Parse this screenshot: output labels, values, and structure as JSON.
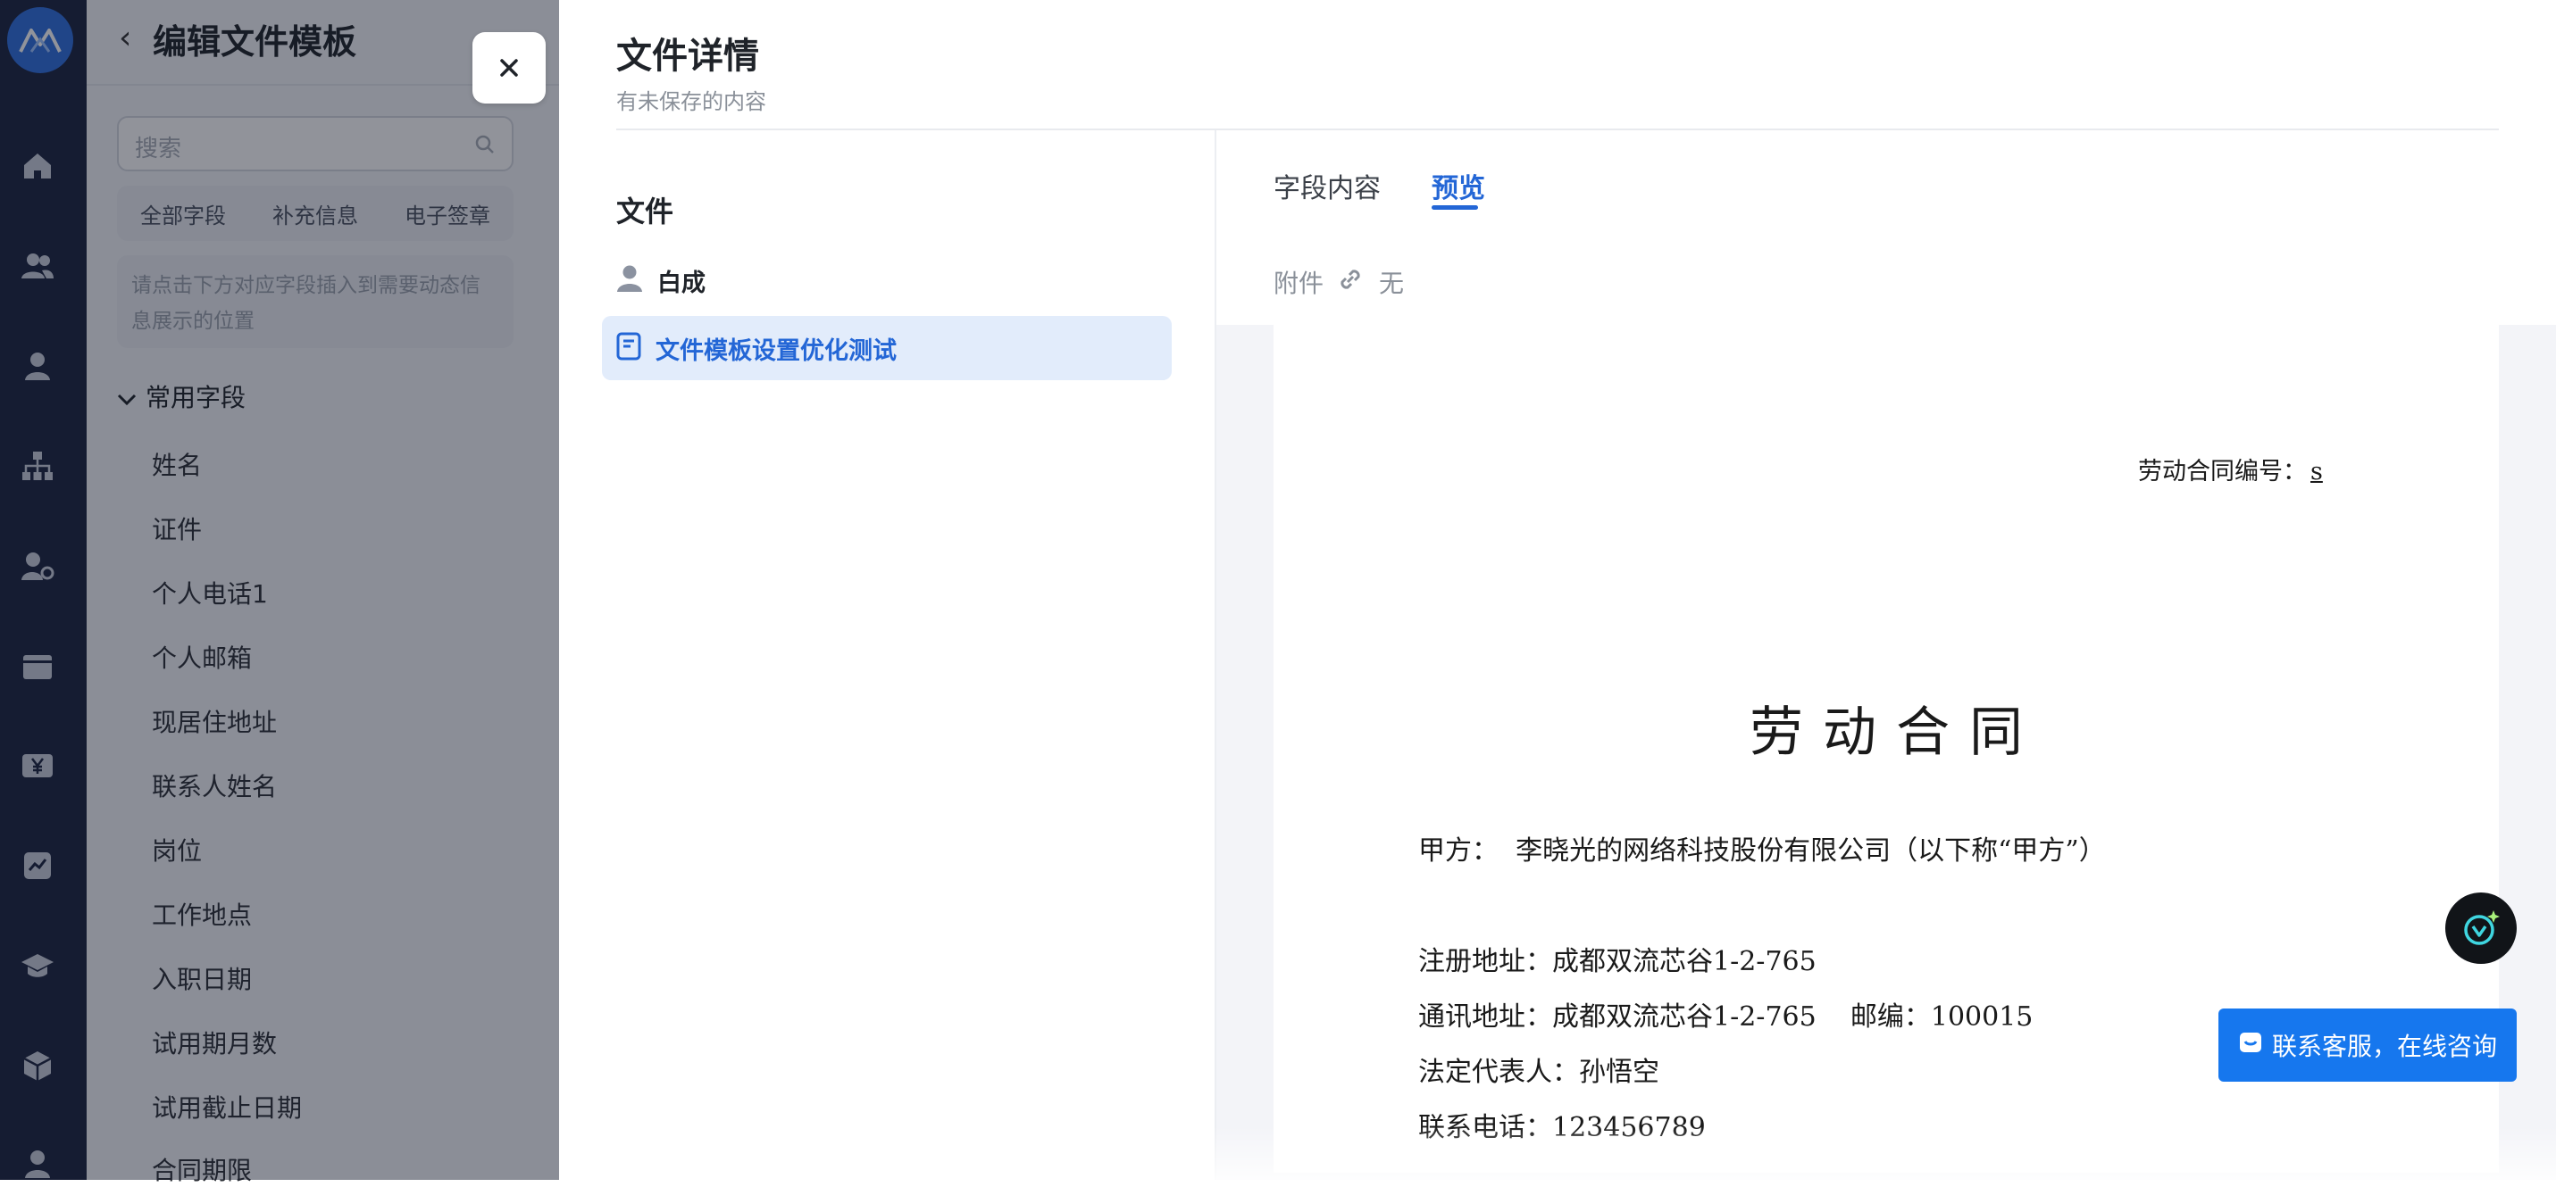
{
  "editor": {
    "title": "编辑文件模板",
    "search_placeholder": "搜索",
    "chips": [
      "全部字段",
      "补充信息",
      "电子签章"
    ],
    "hint": "请点击下方对应字段插入到需要动态信息展示的位置",
    "group_label": "常用字段",
    "fields": [
      "姓名",
      "证件",
      "个人电话1",
      "个人邮箱",
      "现居住地址",
      "联系人姓名",
      "岗位",
      "工作地点",
      "入职日期",
      "试用期月数",
      "试用截止日期",
      "合同期限"
    ]
  },
  "drawer": {
    "title": "文件详情",
    "subtitle": "有未保存的内容",
    "files_label": "文件",
    "person_name": "白成",
    "file_name": "文件模板设置优化测试",
    "tabs": {
      "fields": "字段内容",
      "preview": "预览"
    },
    "attachment_label": "附件",
    "attachment_value": "无"
  },
  "document": {
    "contract_no_label": "劳动合同编号：",
    "contract_no_value": "s",
    "title": "劳动合同",
    "party_a": "甲方：  李晓光的网络科技股份有限公司（以下称“甲方”）",
    "reg_address": "注册地址：成都双流芯谷1-2-765",
    "mail_address": "通讯地址：成都双流芯谷1-2-765    邮编：100015",
    "legal_rep": "法定代表人：孙悟空",
    "phone": "联系电话：123456789"
  },
  "support": {
    "label": "联系客服，在线咨询"
  },
  "colors": {
    "accent": "#2366d6",
    "rail": "#1b2440",
    "support": "#1677ee"
  }
}
